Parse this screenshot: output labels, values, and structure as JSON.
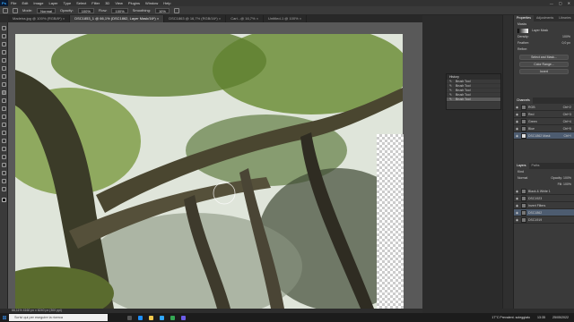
{
  "menubar": {
    "app_logo": "Ps",
    "items": [
      "File",
      "Edit",
      "Image",
      "Layer",
      "Type",
      "Select",
      "Filter",
      "3D",
      "View",
      "Plugins",
      "Window",
      "Help"
    ],
    "winctl": [
      "—",
      "▢",
      "✕"
    ]
  },
  "options": {
    "mode_label": "Mode:",
    "mode_value": "Normal",
    "opacity_label": "Opacity:",
    "opacity_value": "100%",
    "flow_label": "Flow:",
    "flow_value": "100%",
    "smoothing_label": "Smoothing:",
    "smoothing_value": "10%"
  },
  "tabs": [
    {
      "label": "Madeira.jpg @ 100% (RGB/8*) ×"
    },
    {
      "label": "DSC1853_1 @ 66,1% (DSC1862, Layer Mask/16*) ×"
    },
    {
      "label": "DSC1863 @ 16,7% (RGB/16*) ×"
    },
    {
      "label": "Cart...@ 16,7% ×"
    },
    {
      "label": "Untitled-1 @ 100% ×"
    }
  ],
  "status": {
    "text": "66,11%    4160 px x 6240 px (300 ppi)"
  },
  "history": {
    "title": "History",
    "items": [
      "Brush Tool",
      "Brush Tool",
      "Brush Tool",
      "Brush Tool",
      "Brush Tool"
    ]
  },
  "properties": {
    "tabs": [
      "Properties",
      "Adjustments",
      "Libraries"
    ],
    "section": "Masks",
    "mask_label": "Layer Mask",
    "density_label": "Density:",
    "density_value": "100%",
    "feather_label": "Feather:",
    "feather_value": "0,0 px",
    "refine_label": "Refine:",
    "buttons": [
      "Select and Mask...",
      "Color Range...",
      "Invert"
    ]
  },
  "channels": {
    "title": "Channels",
    "items": [
      {
        "name": "RGB",
        "shortcut": "Ctrl+2"
      },
      {
        "name": "Red",
        "shortcut": "Ctrl+3"
      },
      {
        "name": "Green",
        "shortcut": "Ctrl+4"
      },
      {
        "name": "Blue",
        "shortcut": "Ctrl+5"
      },
      {
        "name": "DSC1862 Mask",
        "shortcut": "Ctrl+\\"
      }
    ]
  },
  "layers": {
    "tabs": [
      "Layers",
      "Paths"
    ],
    "kind": "Kind",
    "blend": "Normal",
    "opacity": "Opacity: 100%",
    "fill": "Fill: 100%",
    "items": [
      {
        "name": "Black & White 1"
      },
      {
        "name": "DSC1923"
      },
      {
        "name": "Invert Filters"
      },
      {
        "name": "DSC1862"
      },
      {
        "name": "DSC1919"
      }
    ]
  },
  "taskbar": {
    "search_placeholder": "Scrivi qui per eseguire la ricerca",
    "tray_temp": "17°C  Prevalent. soleggiato",
    "time": "13:35",
    "date": "25/05/2022"
  }
}
